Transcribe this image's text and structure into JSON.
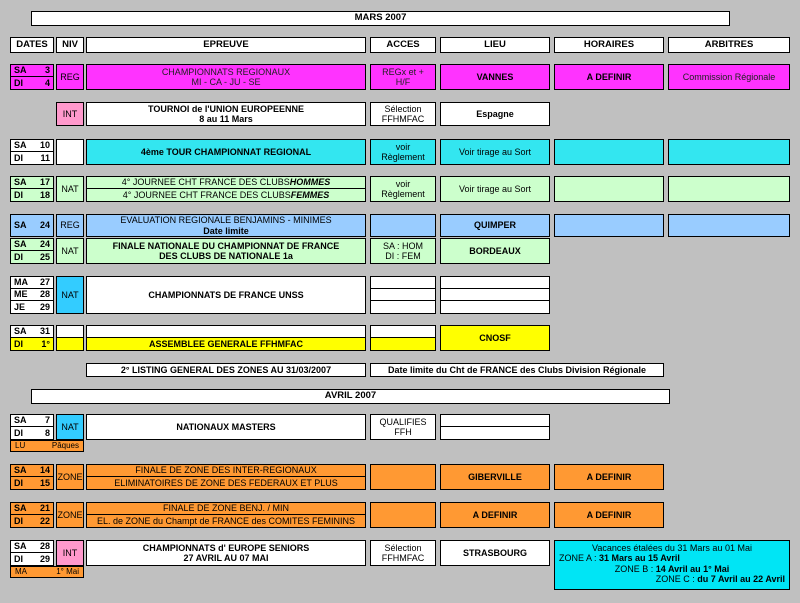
{
  "title_mars": "MARS     2007",
  "title_avril": "AVRIL     2007",
  "headers": {
    "dates": "DATES",
    "niv": "NIV",
    "epreuve": "EPREUVE",
    "acces": "ACCES",
    "lieu": "LIEU",
    "horaires": "HORAIRES",
    "arbitres": "ARBITRES"
  },
  "rows": {
    "r1": {
      "d1": "SA",
      "n1": "3",
      "d2": "DI",
      "n2": "4",
      "niv": "REG",
      "ep1": "CHAMPIONNATS  REGIONAUX",
      "ep2": "MI - CA - JU - SE",
      "acc1": "REGx et +",
      "acc2": "H/F",
      "lieu": "VANNES",
      "hor": "A DEFINIR",
      "arb": "Commission Régionale"
    },
    "r2": {
      "niv": "INT",
      "ep1": "TOURNOI de l'UNION EUROPEENNE",
      "ep2": "8 au 11 Mars",
      "acc1": "Sélection",
      "acc2": "FFHMFAC",
      "lieu": "Espagne"
    },
    "r3": {
      "d1": "SA",
      "n1": "10",
      "d2": "DI",
      "n2": "11",
      "ep": "4ème TOUR CHAMPIONNAT REGIONAL",
      "acc1": "voir",
      "acc2": "Règlement",
      "lieu": "Voir  tirage au Sort"
    },
    "r4": {
      "d1": "SA",
      "n1": "17",
      "d2": "DI",
      "n2": "18",
      "niv": "NAT",
      "ep1a": "4° JOURNEE CHT FRANCE DES CLUBS ",
      "ep1b": "HOMMES",
      "ep2a": "4° JOURNEE CHT FRANCE DES CLUBS ",
      "ep2b": "FEMMES",
      "acc1": "voir",
      "acc2": "Règlement",
      "lieu": "Voir  tirage au Sort"
    },
    "r5": {
      "d": "SA",
      "n": "24",
      "niv": "REG",
      "ep1": "EVALUATION REGIONALE   BENJAMINS - MINIMES",
      "ep2": "Date limite",
      "lieu": "QUIMPER"
    },
    "r6": {
      "d1": "SA",
      "n1": "24",
      "d2": "DI",
      "n2": "25",
      "niv": "NAT",
      "ep1": "FINALE NATIONALE DU CHAMPIONNAT DE FRANCE",
      "ep2": "DES CLUBS DE NATIONALE 1a",
      "acc1": "SA : HOM",
      "acc2": "DI : FEM",
      "lieu": "BORDEAUX"
    },
    "r7": {
      "d1": "MA",
      "n1": "27",
      "d2": "ME",
      "n2": "28",
      "d3": "JE",
      "n3": "29",
      "niv": "NAT",
      "ep": "CHAMPIONNATS  DE FRANCE  UNSS"
    },
    "r8": {
      "d1": "SA",
      "n1": "31",
      "d2": "DI",
      "n2": "1°",
      "ep": "ASSEMBLEE  GENERALE  FFHMFAC",
      "lieu": "CNOSF"
    },
    "listing": "2° LISTING GENERAL DES ZONES AU 31/03/2007",
    "datelimite": "Date limite du Cht de FRANCE des Clubs Division Régionale",
    "r9": {
      "d1": "SA",
      "n1": "7",
      "d2": "DI",
      "n2": "8",
      "niv": "NAT",
      "lu": "LU",
      "paques": "Pâques",
      "ep": "NATIONAUX  MASTERS",
      "acc1": "QUALIFIES",
      "acc2": "FFH"
    },
    "r10": {
      "d1": "SA",
      "n1": "14",
      "d2": "DI",
      "n2": "15",
      "niv": "ZONE",
      "ep1": "FINALE DE ZONE DES INTER-REGIONAUX",
      "ep2": "ELIMINATOIRES DE ZONE DES FEDERAUX ET PLUS",
      "lieu": "GIBERVILLE",
      "hor": "A DEFINIR"
    },
    "r11": {
      "d1": "SA",
      "n1": "21",
      "d2": "DI",
      "n2": "22",
      "niv": "ZONE",
      "ep1": "FINALE DE ZONE BENJ. / MIN",
      "ep2": "EL. de ZONE du Champt de FRANCE des COMITES FEMININS",
      "lieu": "A DEFINIR",
      "hor": "A DEFINIR"
    },
    "r12": {
      "d1": "SA",
      "n1": "28",
      "d2": "DI",
      "n2": "29",
      "niv": "INT",
      "ma": "MA",
      "mai": "1° Mai",
      "ep1": "CHAMPIONNATS  d' EUROPE  SENIORS",
      "ep2": "27 AVRIL  AU 07 MAI",
      "acc1": "Sélection",
      "acc2": "FFHMFAC",
      "lieu": "STRASBOURG"
    }
  },
  "vacances": {
    "title": "Vacances étalées du 31 Mars au 01 Mai",
    "a_label": "ZONE A : ",
    "a_val": "31 Mars au 15 Avril",
    "b_label": "ZONE B : ",
    "b_val": "14 Avril au 1° Mai",
    "c_label": "ZONE C : ",
    "c_val": " du 7 Avril au 22 Avril"
  }
}
